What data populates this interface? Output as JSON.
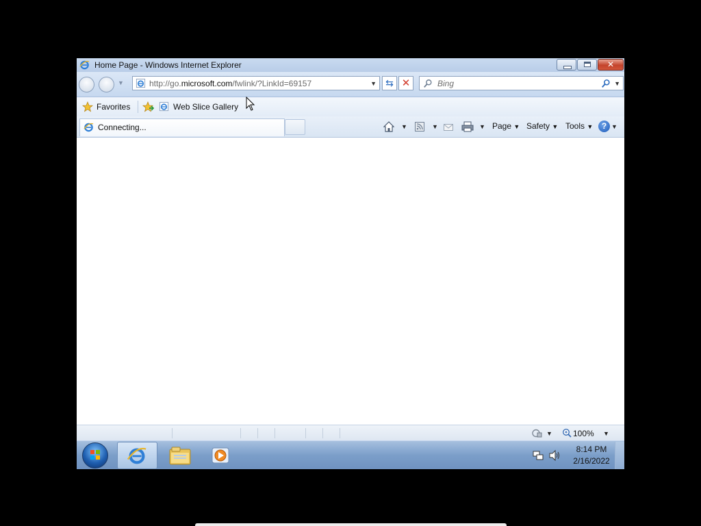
{
  "window": {
    "title": "Home Page - Windows Internet Explorer"
  },
  "nav": {
    "address_prefix": "http://go.",
    "address_domain": "microsoft.com",
    "address_path": "/fwlink/?LinkId=69157",
    "search_placeholder": "Bing"
  },
  "favorites_bar": {
    "favorites_label": "Favorites",
    "web_slice_label": "Web Slice Gallery"
  },
  "tab": {
    "label": "Connecting..."
  },
  "command_bar": {
    "page_label": "Page",
    "safety_label": "Safety",
    "tools_label": "Tools"
  },
  "status_bar": {
    "zoom": "100%"
  },
  "taskbar": {
    "time": "8:14 PM",
    "date": "2/16/2022",
    "icons": [
      "start-orb-icon",
      "internet-explorer-icon",
      "windows-explorer-icon",
      "media-player-icon",
      "network-icon",
      "volume-icon"
    ]
  },
  "colors": {
    "titlebar": "#c9daf0",
    "close_button": "#c4442c",
    "taskbar": "#7b9ec9",
    "link_blue": "#2c6cbf"
  }
}
